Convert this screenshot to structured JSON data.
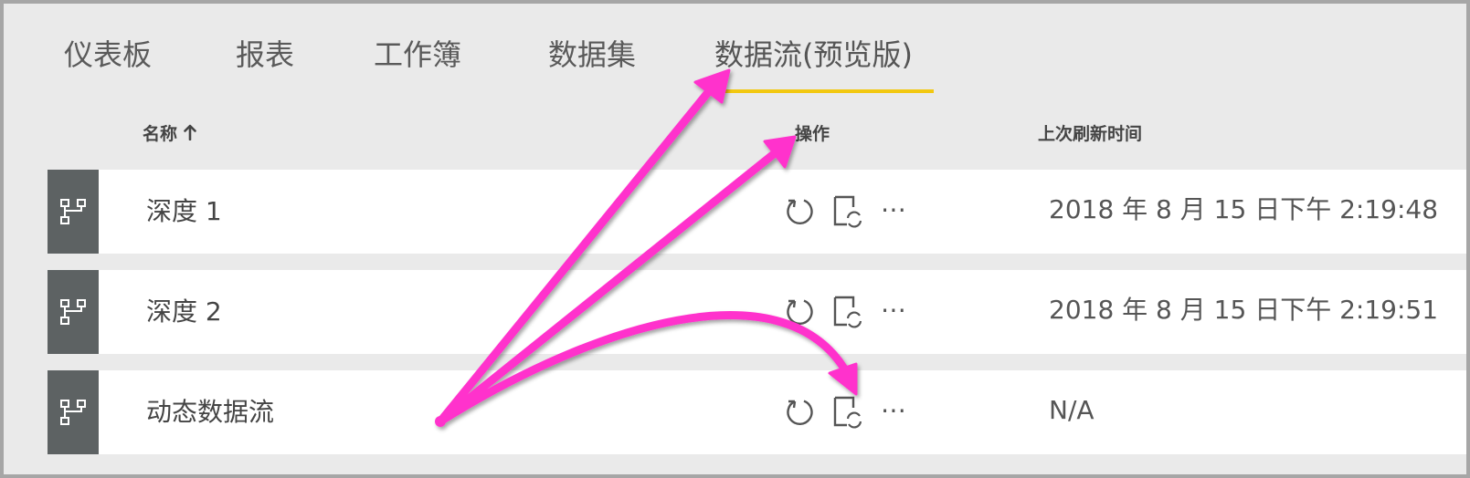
{
  "tabs": [
    {
      "label": "仪表板"
    },
    {
      "label": "报表"
    },
    {
      "label": "工作簿"
    },
    {
      "label": "数据集"
    },
    {
      "label": "数据流(预览版)",
      "active": true
    }
  ],
  "columns": {
    "name": "名称",
    "sort_icon": "arrow-up-icon",
    "actions": "操作",
    "last_refresh": "上次刷新时间"
  },
  "rows": [
    {
      "name": "深度 1",
      "last_refresh": "2018 年 8 月 15 日下午 2:19:48"
    },
    {
      "name": "深度 2",
      "last_refresh": "2018 年 8 月 15 日下午 2:19:51"
    },
    {
      "name": "动态数据流",
      "last_refresh": "N/A"
    }
  ],
  "row_icons": {
    "type": "dataflow-icon",
    "refresh": "refresh-icon",
    "schedule": "schedule-refresh-icon",
    "more": "more-options-icon"
  },
  "more_glyph": "⋯",
  "colors": {
    "accent_underline": "#f2c811",
    "annotation_arrow": "#ff33cc",
    "row_icon_bg": "#5d6263"
  }
}
